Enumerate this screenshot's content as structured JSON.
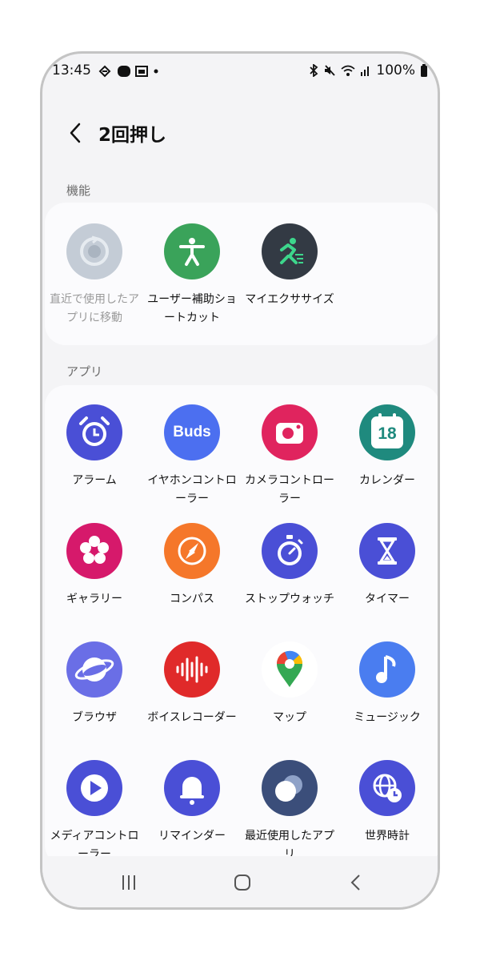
{
  "status": {
    "time": "13:45",
    "battery": "100%"
  },
  "header": {
    "title": "2回押し"
  },
  "sections": {
    "features": "機能",
    "apps": "アプリ"
  },
  "features": [
    {
      "label": "直近で使用したアプリに移動",
      "color": "#c4ccd6",
      "icon": "recent-rotate-icon",
      "disabled": true
    },
    {
      "label": "ユーザー補助ショートカット",
      "color": "#3aa35a",
      "icon": "accessibility-icon"
    },
    {
      "label": "マイエクササイズ",
      "color": "#333a44",
      "icon": "running-icon"
    }
  ],
  "apps": [
    {
      "label": "アラーム",
      "color": "#4a4fd6",
      "icon": "alarm-clock-icon"
    },
    {
      "label": "イヤホンコントローラー",
      "color": "#4c6ff0",
      "icon": "buds-icon",
      "text": "Buds"
    },
    {
      "label": "カメラコントローラー",
      "color": "#e0245e",
      "icon": "camera-icon"
    },
    {
      "label": "カレンダー",
      "color": "#1f8a7e",
      "icon": "calendar-icon",
      "text": "18"
    },
    {
      "label": "ギャラリー",
      "color": "#d6196b",
      "icon": "gallery-flower-icon"
    },
    {
      "label": "コンパス",
      "color": "#f5772a",
      "icon": "compass-icon"
    },
    {
      "label": "ストップウォッチ",
      "color": "#4a4fd6",
      "icon": "stopwatch-icon"
    },
    {
      "label": "タイマー",
      "color": "#4a4fd6",
      "icon": "hourglass-icon"
    },
    {
      "label": "ブラウザ",
      "color": "#6a6ee6",
      "icon": "browser-planet-icon"
    },
    {
      "label": "ボイスレコーダー",
      "color": "#e02a2a",
      "icon": "voice-wave-icon"
    },
    {
      "label": "マップ",
      "color": "#ffffff",
      "icon": "maps-pin-icon"
    },
    {
      "label": "ミュージック",
      "color": "#4a7df0",
      "icon": "music-note-icon"
    },
    {
      "label": "メディアコントローラー",
      "color": "#4a4fd6",
      "icon": "play-icon"
    },
    {
      "label": "リマインダー",
      "color": "#4a4fd6",
      "icon": "bell-icon"
    },
    {
      "label": "最近使用したアプリ",
      "color": "#3b4e7a",
      "icon": "recent-apps-icon"
    },
    {
      "label": "世界時計",
      "color": "#4a4fd6",
      "icon": "world-clock-icon"
    }
  ]
}
